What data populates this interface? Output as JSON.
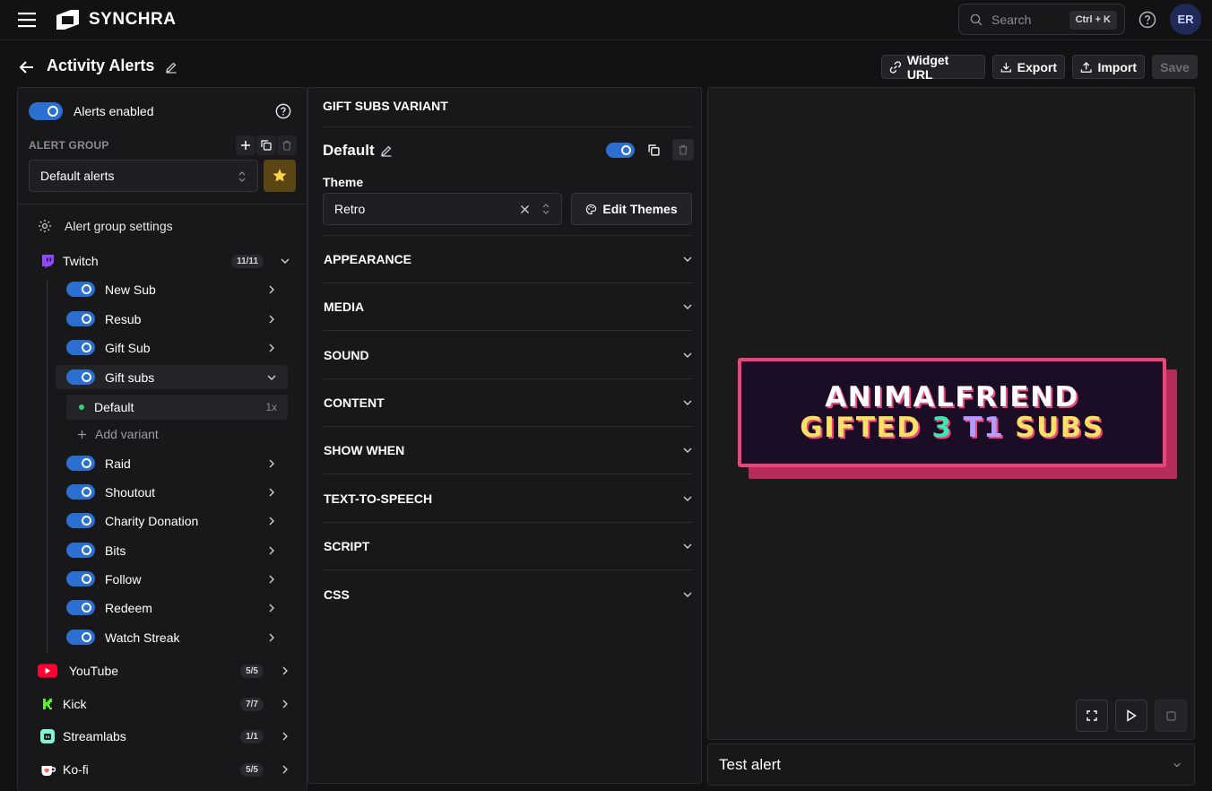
{
  "app": {
    "brand": "SYNCHRA",
    "search_placeholder": "Search",
    "search_shortcut": "Ctrl + K",
    "avatar_initials": "ER"
  },
  "page": {
    "title": "Activity Alerts"
  },
  "toolbar": {
    "widget_url": "Widget URL",
    "export": "Export",
    "import": "Import",
    "save": "Save"
  },
  "left": {
    "alerts_enabled_label": "Alerts enabled",
    "alert_group_label": "ALERT GROUP",
    "alert_group_value": "Default alerts",
    "settings_label": "Alert group settings",
    "platforms": [
      {
        "name": "Twitch",
        "count": "11/11",
        "icon": "twitch-icon",
        "color": "#9146ff"
      },
      {
        "name": "YouTube",
        "count": "5/5",
        "icon": "youtube-icon",
        "color": "#ff0033"
      },
      {
        "name": "Kick",
        "count": "7/7",
        "icon": "kick-icon",
        "color": "#53fc18"
      },
      {
        "name": "Streamlabs",
        "count": "1/1",
        "icon": "streamlabs-icon",
        "color": "#80f5d2"
      },
      {
        "name": "Ko-fi",
        "count": "5/5",
        "icon": "kofi-icon",
        "color": "#ff5e5b"
      }
    ],
    "twitch_events": [
      "New Sub",
      "Resub",
      "Gift Sub",
      "Gift subs",
      "Raid",
      "Shoutout",
      "Charity Donation",
      "Bits",
      "Follow",
      "Redeem",
      "Watch Streak"
    ],
    "variant": {
      "name": "Default",
      "weight": "1x"
    },
    "add_variant": "Add variant"
  },
  "middle": {
    "header": "GIFT SUBS VARIANT",
    "variant_name": "Default",
    "theme_label": "Theme",
    "theme_value": "Retro",
    "edit_themes": "Edit Themes",
    "sections": [
      "APPEARANCE",
      "MEDIA",
      "SOUND",
      "CONTENT",
      "SHOW WHEN",
      "TEXT-TO-SPEECH",
      "SCRIPT",
      "CSS"
    ]
  },
  "preview": {
    "line1": "ANIMALFRIEND",
    "line2_parts": [
      "GIFTED",
      "3",
      "T1",
      "SUBS"
    ],
    "colors": {
      "frame": "#f0437a",
      "bg": "#1c0d26",
      "yellow": "#ffe066",
      "teal": "#3ee6b4",
      "purple": "#b49cff"
    },
    "test_alert": "Test alert"
  }
}
